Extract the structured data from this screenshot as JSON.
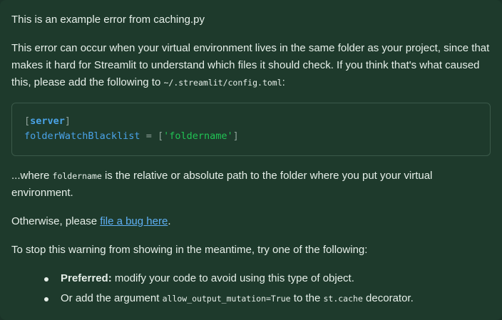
{
  "title": "This is an example error from caching.py",
  "paragraph1": {
    "text_before": "This error can occur when your virtual environment lives in the same folder as your project, since that makes it hard for Streamlit to understand which files it should check. If you think that's what caused this, please add the following to ",
    "code": "~/.streamlit/config.toml",
    "text_after": ":"
  },
  "code_block": {
    "line1": {
      "open": "[",
      "section": "server",
      "close": "]"
    },
    "line2": {
      "key": "folderWatchBlacklist",
      "eq": " = ",
      "open": "[",
      "value": "'foldername'",
      "close": "]"
    }
  },
  "paragraph2": {
    "text_before": "...where ",
    "code": "foldername",
    "text_after": " is the relative or absolute path to the folder where you put your virtual environment."
  },
  "paragraph3": {
    "text_before": "Otherwise, please ",
    "link": "file a bug here",
    "text_after": "."
  },
  "paragraph4": "To stop this warning from showing in the meantime, try one of the following:",
  "options": [
    {
      "bold": "Preferred:",
      "text": " modify your code to avoid using this type of object."
    },
    {
      "text_before": "Or add the argument ",
      "code1": "allow_output_mutation=True",
      "text_mid": " to the ",
      "code2": "st.cache",
      "text_after": " decorator."
    }
  ],
  "colors": {
    "background": "#1e3a2c",
    "text": "#e6efe9",
    "link": "#5fb0f5",
    "code_key": "#4aa3e8",
    "code_string": "#21c354"
  }
}
